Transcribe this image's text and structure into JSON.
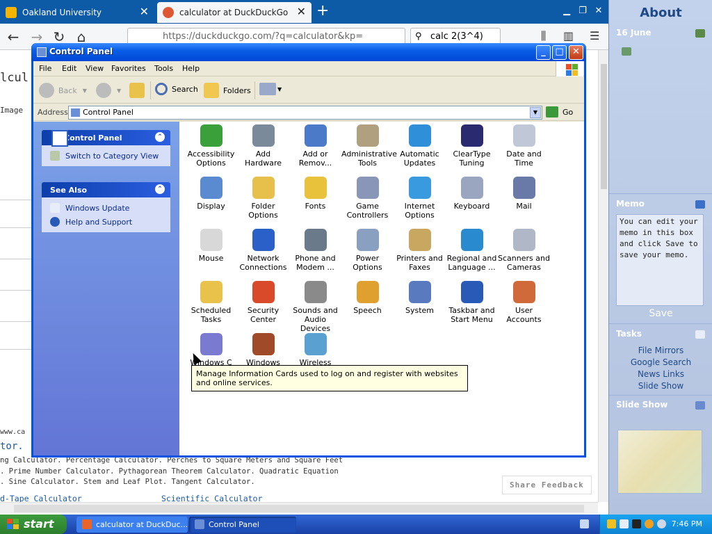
{
  "browser": {
    "tabs": [
      {
        "label": "Oakland University"
      },
      {
        "label": "calculator at DuckDuckGo"
      }
    ],
    "url": "https://duckduckgo.com/?q=calculator&kp=",
    "search_value": "calc 2(3^4)",
    "page_fragments": {
      "title_partial": "lcul",
      "images_partial": "Image",
      "link_partial": "www.ca",
      "tor": "tor.",
      "line1": "ng Calculator. Percentage Calculator. Perches to Square Meters and Square Feet",
      "line2": ". Prime Number Calculator. Pythagorean Theorem Calculator. Quadratic Equation",
      "line3": ". Sine Calculator. Stem and Leaf Plot. Tangent Calculator.",
      "line4a": "d-Tape Calculator",
      "line4b": "Scientific Calculator",
      "share_feedback": "Share Feedback"
    }
  },
  "control_panel": {
    "title": "Control Panel",
    "menu": [
      "File",
      "Edit",
      "View",
      "Favorites",
      "Tools",
      "Help"
    ],
    "toolbar": {
      "back": "Back",
      "search": "Search",
      "folders": "Folders"
    },
    "address": {
      "label": "Address",
      "value": "Control Panel",
      "go": "Go"
    },
    "left_pane": {
      "cp_header": "Control Panel",
      "switch_view": "Switch to Category View",
      "see_also_header": "See Also",
      "see_also": [
        "Windows Update",
        "Help and Support"
      ]
    },
    "icons": [
      {
        "label": "Accessibility Options",
        "color": "#3aa03a"
      },
      {
        "label": "Add Hardware",
        "color": "#7a8a9a"
      },
      {
        "label": "Add or Remov...",
        "color": "#4a7ac8"
      },
      {
        "label": "Administrative Tools",
        "color": "#b0a080"
      },
      {
        "label": "Automatic Updates",
        "color": "#2f8fd8"
      },
      {
        "label": "ClearType Tuning",
        "color": "#2a2a70"
      },
      {
        "label": "Date and Time",
        "color": "#c0c8d8"
      },
      {
        "label": "Display",
        "color": "#5a8ad0"
      },
      {
        "label": "Folder Options",
        "color": "#e6c04a"
      },
      {
        "label": "Fonts",
        "color": "#e8c23a"
      },
      {
        "label": "Game Controllers",
        "color": "#8a96b8"
      },
      {
        "label": "Internet Options",
        "color": "#3a9adf"
      },
      {
        "label": "Keyboard",
        "color": "#9aa6c0"
      },
      {
        "label": "Mail",
        "color": "#6a7aa8"
      },
      {
        "label": "Mouse",
        "color": "#d8d8d8"
      },
      {
        "label": "Network Connections",
        "color": "#2a60c8"
      },
      {
        "label": "Phone and Modem ...",
        "color": "#6a7a8a"
      },
      {
        "label": "Power Options",
        "color": "#8aa0c0"
      },
      {
        "label": "Printers and Faxes",
        "color": "#c8a860"
      },
      {
        "label": "Regional and Language ...",
        "color": "#2a8ad0"
      },
      {
        "label": "Scanners and Cameras",
        "color": "#b0b8c8"
      },
      {
        "label": "Scheduled Tasks",
        "color": "#e8c24a"
      },
      {
        "label": "Security Center",
        "color": "#d84a2a"
      },
      {
        "label": "Sounds and Audio Devices",
        "color": "#8a8a8a"
      },
      {
        "label": "Speech",
        "color": "#e0a030"
      },
      {
        "label": "System",
        "color": "#5a7ac0"
      },
      {
        "label": "Taskbar and Start Menu",
        "color": "#2a5ab8"
      },
      {
        "label": "User Accounts",
        "color": "#d06a3a"
      },
      {
        "label": "Windows C",
        "color": "#7a7ad0"
      },
      {
        "label": "Windows",
        "color": "#a04a2a"
      },
      {
        "label": "Wireless",
        "color": "#5aa0d0"
      }
    ],
    "tooltip": "Manage Information Cards used to log on and register with websites and online services."
  },
  "sidebar": {
    "title": "About",
    "date": "16 June",
    "memo_header": "Memo",
    "memo_text": "You can edit your memo in this box and click Save to save your memo.",
    "memo_save": "Save",
    "tasks_header": "Tasks",
    "tasks": [
      "File Mirrors",
      "Google Search",
      "News Links",
      "Slide Show"
    ],
    "slideshow_header": "Slide Show"
  },
  "taskbar": {
    "start": "start",
    "tasks": [
      "calculator at DuckDuc...",
      "Control Panel"
    ],
    "clock": "7:46 PM"
  }
}
